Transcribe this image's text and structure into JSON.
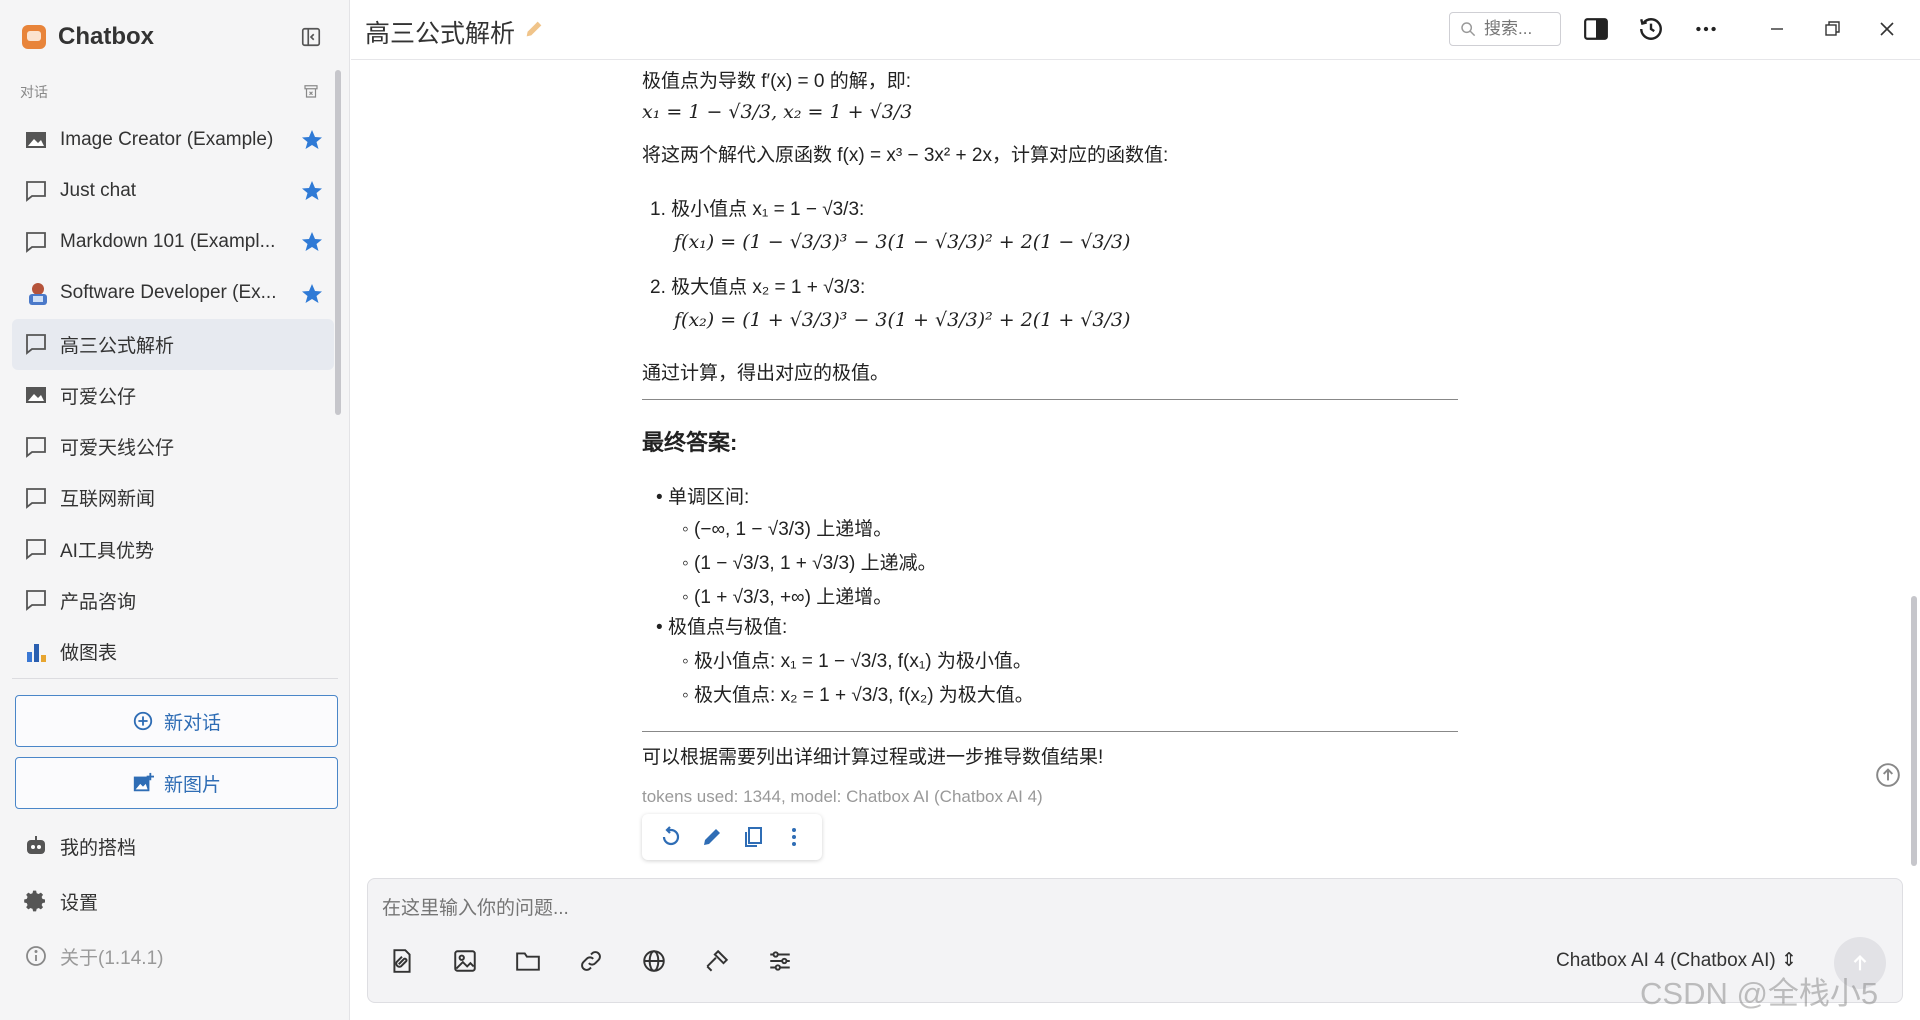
{
  "app": {
    "name": "Chatbox"
  },
  "sidebar": {
    "section_label": "对话",
    "conversations": [
      {
        "label": "Image Creator (Example)",
        "icon": "image-icon",
        "starred": true
      },
      {
        "label": "Just chat",
        "icon": "chat-bubble-icon",
        "starred": true
      },
      {
        "label": "Markdown 101 (Exampl...",
        "icon": "chat-bubble-icon",
        "starred": true
      },
      {
        "label": "Software Developer (Ex...",
        "icon": "developer-avatar-icon",
        "starred": true
      },
      {
        "label": "高三公式解析",
        "icon": "chat-bubble-icon",
        "starred": false,
        "active": true
      },
      {
        "label": "可爱公仔",
        "icon": "image-icon",
        "starred": false
      },
      {
        "label": "可爱天线公仔",
        "icon": "chat-bubble-icon",
        "starred": false
      },
      {
        "label": "互联网新闻",
        "icon": "chat-bubble-icon",
        "starred": false
      },
      {
        "label": "AI工具优势",
        "icon": "chat-bubble-icon",
        "starred": false
      },
      {
        "label": "产品咨询",
        "icon": "chat-bubble-icon",
        "starred": false
      },
      {
        "label": "做图表",
        "icon": "bar-chart-icon",
        "starred": false
      }
    ],
    "new_chat_label": "新对话",
    "new_image_label": "新图片",
    "my_partners_label": "我的搭档",
    "settings_label": "设置",
    "about_label": "关于(1.14.1)"
  },
  "header": {
    "title": "高三公式解析",
    "search_placeholder": "搜索..."
  },
  "message": {
    "l1": "极值点为导数 f′(x) = 0 的解，即:",
    "l2": "x₁ = 1 − √3/3,    x₂ = 1 + √3/3",
    "l3": "将这两个解代入原函数 f(x) = x³ − 3x² + 2x，计算对应的函数值:",
    "item1_title": "1. 极小值点 x₁ = 1 − √3/3:",
    "item1_formula": "f(x₁) = (1 − √3/3)³ − 3(1 − √3/3)² + 2(1 − √3/3)",
    "item2_title": "2. 极大值点 x₂ = 1 + √3/3:",
    "item2_formula": "f(x₂) = (1 + √3/3)³ − 3(1 + √3/3)² + 2(1 + √3/3)",
    "l4": "通过计算，得出对应的极值。",
    "final_heading": "最终答案:",
    "mono_title": "单调区间:",
    "mono_items": [
      "(−∞, 1 − √3/3) 上递增。",
      "(1 − √3/3, 1 + √3/3) 上递减。",
      "(1 + √3/3, +∞) 上递增。"
    ],
    "extrema_title": "极值点与极值:",
    "extrema_items": [
      "极小值点: x₁ = 1 − √3/3, f(x₁) 为极小值。",
      "极大值点: x₂ = 1 + √3/3, f(x₂) 为极大值。"
    ],
    "closing": "可以根据需要列出详细计算过程或进一步推导数值结果!",
    "meta": "tokens used: 1344, model: Chatbox AI (Chatbox AI 4)"
  },
  "input": {
    "placeholder": "在这里输入你的问题...",
    "model_label": "Chatbox AI 4 (Chatbox AI) ⇕"
  },
  "watermark": "CSDN @全栈小5",
  "colors": {
    "accent": "#2f6db5",
    "star": "#2f7ad6",
    "active_bg": "#e7eaf0"
  }
}
